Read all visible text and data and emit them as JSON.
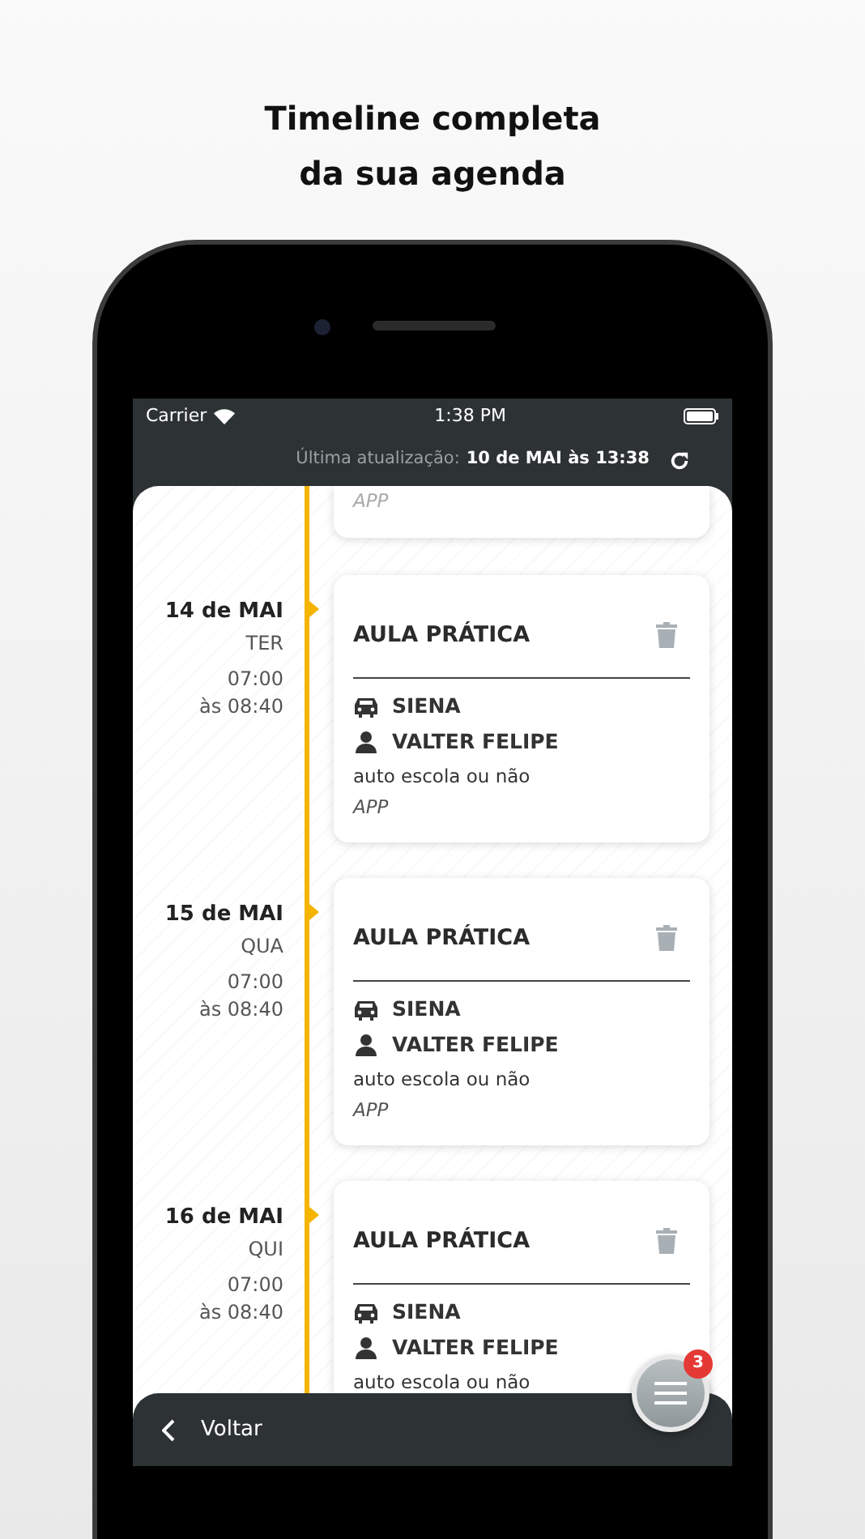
{
  "headline": [
    "Timeline completa",
    "da sua agenda"
  ],
  "status_bar": {
    "carrier": "Carrier",
    "time": "1:38 PM"
  },
  "last_update": {
    "label": "Última atualização:",
    "value": "10 de MAI às 13:38"
  },
  "partial_entry": {
    "source": "APP"
  },
  "entries": [
    {
      "date": "14 de MAI",
      "weekday": "TER",
      "start": "07:00",
      "end": "às 08:40",
      "title": "AULA PRÁTICA",
      "vehicle": "SIENA",
      "instructor": "VALTER FELIPE",
      "school": "auto escola ou não",
      "source": "APP"
    },
    {
      "date": "15 de MAI",
      "weekday": "QUA",
      "start": "07:00",
      "end": "às 08:40",
      "title": "AULA PRÁTICA",
      "vehicle": "SIENA",
      "instructor": "VALTER FELIPE",
      "school": "auto escola ou não",
      "source": "APP"
    },
    {
      "date": "16 de MAI",
      "weekday": "QUI",
      "start": "07:00",
      "end": "às 08:40",
      "title": "AULA PRÁTICA",
      "vehicle": "SIENA",
      "instructor": "VALTER FELIPE",
      "school": "auto escola ou não"
    }
  ],
  "back_button": "Voltar",
  "menu_badge": "3"
}
